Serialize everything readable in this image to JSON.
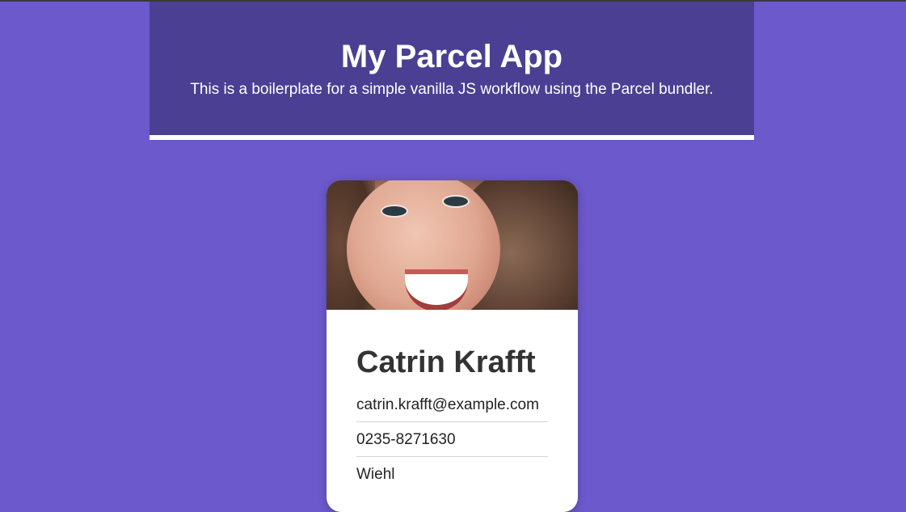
{
  "header": {
    "title": "My Parcel App",
    "subtitle": "This is a boilerplate for a simple vanilla JS workflow using the Parcel bundler."
  },
  "card": {
    "name": "Catrin Krafft",
    "email": "catrin.krafft@example.com",
    "phone": "0235-8271630",
    "city": "Wiehl"
  },
  "colors": {
    "background": "#6c59cc",
    "header_bg": "#4b3f93",
    "card_bg": "#ffffff"
  }
}
